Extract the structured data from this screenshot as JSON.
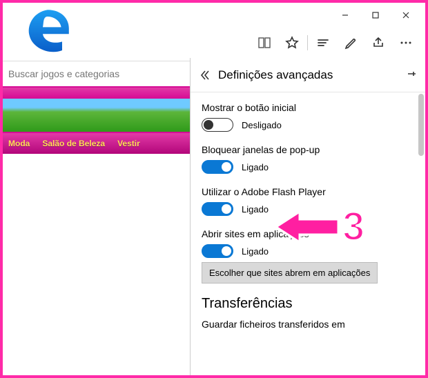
{
  "window": {
    "minimize": "—",
    "maximize": "□",
    "close": "×"
  },
  "toolbar_icons": {
    "reading": "reading-list",
    "favorite": "favorite",
    "hub": "hub",
    "note": "web-note",
    "share": "share",
    "more": "more"
  },
  "page": {
    "search_placeholder": "Buscar jogos e categorias",
    "categories": [
      "Moda",
      "Salão de Beleza",
      "Vestir"
    ]
  },
  "panel": {
    "title": "Definições avançadas",
    "settings": [
      {
        "label": "Mostrar o botão inicial",
        "state_on": false,
        "state_label": "Desligado"
      },
      {
        "label": "Bloquear janelas de pop-up",
        "state_on": true,
        "state_label": "Ligado"
      },
      {
        "label": "Utilizar o Adobe Flash Player",
        "state_on": true,
        "state_label": "Ligado"
      },
      {
        "label": "Abrir sites em aplicações",
        "state_on": true,
        "state_label": "Ligado"
      }
    ],
    "choose_sites_btn": "Escolher que sites abrem em aplicações",
    "downloads_header": "Transferências",
    "downloads_sub": "Guardar ficheiros transferidos em"
  },
  "annotation": {
    "number": "3"
  }
}
